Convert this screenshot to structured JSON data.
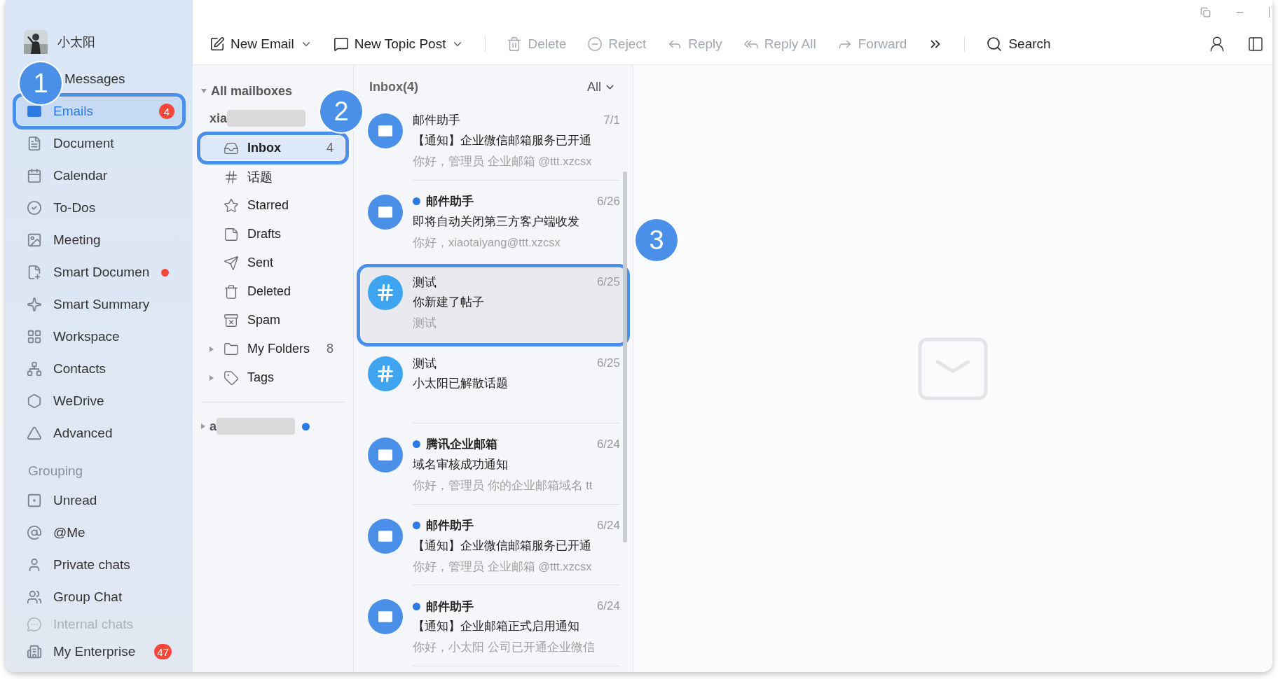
{
  "sidebar": {
    "user": {
      "name": "小太阳"
    },
    "items": [
      {
        "label": "Messages",
        "selected": false
      },
      {
        "label": "Emails",
        "selected": true,
        "badge": "4",
        "callout": "1"
      },
      {
        "label": "Document",
        "selected": false
      },
      {
        "label": "Calendar",
        "selected": false
      },
      {
        "label": "To-Dos",
        "selected": false
      },
      {
        "label": "Meeting",
        "selected": false
      },
      {
        "label": "Smart Documen",
        "selected": false,
        "dot": true
      },
      {
        "label": "Smart Summary",
        "selected": false
      },
      {
        "label": "Workspace",
        "selected": false
      },
      {
        "label": "Contacts",
        "selected": false
      },
      {
        "label": "WeDrive",
        "selected": false
      },
      {
        "label": "Advanced",
        "selected": false
      }
    ],
    "group_title": "Grouping",
    "groups": [
      {
        "label": "Unread",
        "faded": false
      },
      {
        "label": "@Me",
        "faded": false
      },
      {
        "label": "Private chats",
        "faded": false
      },
      {
        "label": "Group Chat",
        "faded": false
      },
      {
        "label": "Internal chats",
        "faded": true
      }
    ],
    "bottom": {
      "label": "My Enterprise",
      "badge": "47"
    }
  },
  "toolbar": {
    "actions": [
      {
        "label": "New Email",
        "disabled": false,
        "dropdown": true
      },
      {
        "label": "New Topic Post",
        "disabled": false,
        "dropdown": true
      },
      {
        "label": "Delete",
        "disabled": true,
        "dropdown": false
      },
      {
        "label": "Reject",
        "disabled": true,
        "dropdown": false
      },
      {
        "label": "Reply",
        "disabled": true,
        "dropdown": false
      },
      {
        "label": "Reply All",
        "disabled": true,
        "dropdown": false
      },
      {
        "label": "Forward",
        "disabled": true,
        "dropdown": false
      }
    ],
    "search": "Search"
  },
  "mailboxes": {
    "title": "All mailboxes",
    "expanded": true,
    "accounts": [
      {
        "name": "xia",
        "unread": false,
        "callout": "2",
        "folders": [
          {
            "label": "Inbox",
            "count": "4",
            "selected": true
          },
          {
            "label": "话题",
            "selected": false
          },
          {
            "label": "Starred",
            "selected": false
          },
          {
            "label": "Drafts",
            "selected": false
          },
          {
            "label": "Sent",
            "selected": false
          },
          {
            "label": "Deleted",
            "selected": false
          },
          {
            "label": "Spam",
            "selected": false
          },
          {
            "label": "My Folders",
            "count": "8",
            "selected": false,
            "expanded": false
          },
          {
            "label": "Tags",
            "selected": false,
            "expanded": false
          }
        ]
      },
      {
        "name": "a",
        "unread": true
      }
    ]
  },
  "list": {
    "title": "Inbox(4)",
    "filter": "All",
    "items": [
      {
        "kind": "mail",
        "sender": "邮件助手",
        "date": "7/1",
        "subject": "【通知】企业微信邮箱服务已开通",
        "preview": "你好，管理员 企业邮箱 @ttt.xzcsx",
        "unread": false,
        "selected": false
      },
      {
        "kind": "mail",
        "sender": "邮件助手",
        "date": "6/26",
        "subject": "即将自动关闭第三方客户端收发",
        "preview": "你好，xiaotaiyang@ttt.xzcsx",
        "unread": true,
        "selected": false
      },
      {
        "kind": "topic",
        "sender": "测试",
        "date": "6/25",
        "subject": "你新建了帖子",
        "preview": "测试",
        "unread": false,
        "selected": true,
        "callout": "3"
      },
      {
        "kind": "topic",
        "sender": "测试",
        "date": "6/25",
        "subject": "小太阳已解散话题",
        "unread": false,
        "selected": false
      },
      {
        "kind": "mail",
        "sender": "腾讯企业邮箱",
        "date": "6/24",
        "subject": "域名审核成功通知",
        "preview": "你好，管理员 你的企业邮箱域名 tt",
        "unread": true,
        "selected": false
      },
      {
        "kind": "mail",
        "sender": "邮件助手",
        "date": "6/24",
        "subject": "【通知】企业微信邮箱服务已开通",
        "preview": "你好，管理员 企业邮箱 @ttt.xzcsx",
        "unread": true,
        "selected": false
      },
      {
        "kind": "mail",
        "sender": "邮件助手",
        "date": "6/24",
        "subject": "【通知】企业邮箱正式启用通知",
        "preview": "你好，小太阳 公司已开通企业微信",
        "unread": true,
        "selected": false
      }
    ]
  }
}
